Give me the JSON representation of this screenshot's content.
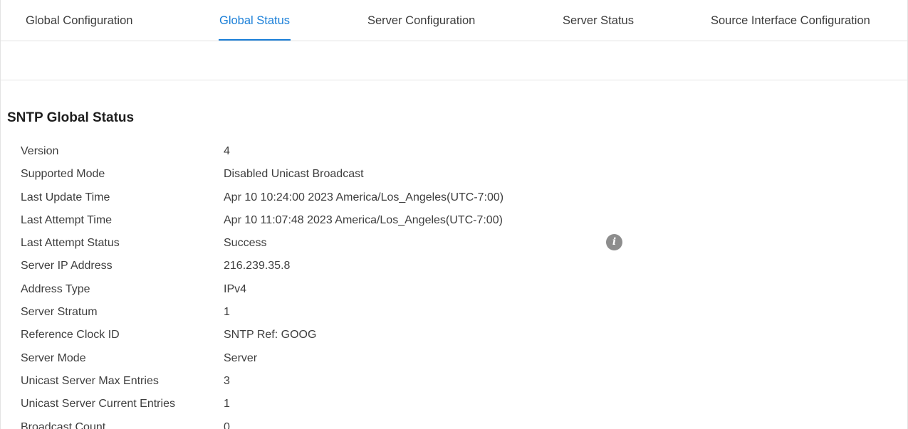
{
  "tabs": [
    {
      "label": "Global Configuration",
      "active": false
    },
    {
      "label": "Global Status",
      "active": true
    },
    {
      "label": "Server Configuration",
      "active": false
    },
    {
      "label": "Server Status",
      "active": false
    },
    {
      "label": "Source Interface Configuration",
      "active": false
    }
  ],
  "section": {
    "title": "SNTP Global Status"
  },
  "status": [
    {
      "label": "Version",
      "value": "4"
    },
    {
      "label": "Supported Mode",
      "value": "Disabled Unicast Broadcast"
    },
    {
      "label": "Last Update Time",
      "value": "Apr 10 10:24:00 2023 America/Los_Angeles(UTC-7:00)"
    },
    {
      "label": "Last Attempt Time",
      "value": "Apr 10 11:07:48 2023 America/Los_Angeles(UTC-7:00)"
    },
    {
      "label": "Last Attempt Status",
      "value": "Success"
    },
    {
      "label": "Server IP Address",
      "value": "216.239.35.8"
    },
    {
      "label": "Address Type",
      "value": "IPv4"
    },
    {
      "label": "Server Stratum",
      "value": "1"
    },
    {
      "label": "Reference Clock ID",
      "value": "SNTP Ref: GOOG"
    },
    {
      "label": "Server Mode",
      "value": "Server"
    },
    {
      "label": "Unicast Server Max Entries",
      "value": "3"
    },
    {
      "label": "Unicast Server Current Entries",
      "value": "1"
    },
    {
      "label": "Broadcast Count",
      "value": "0"
    }
  ],
  "icons": {
    "info": "info-icon",
    "info_glyph": "i"
  },
  "colors": {
    "accent": "#1a7fd8",
    "info_icon": "#8d8d8d"
  }
}
